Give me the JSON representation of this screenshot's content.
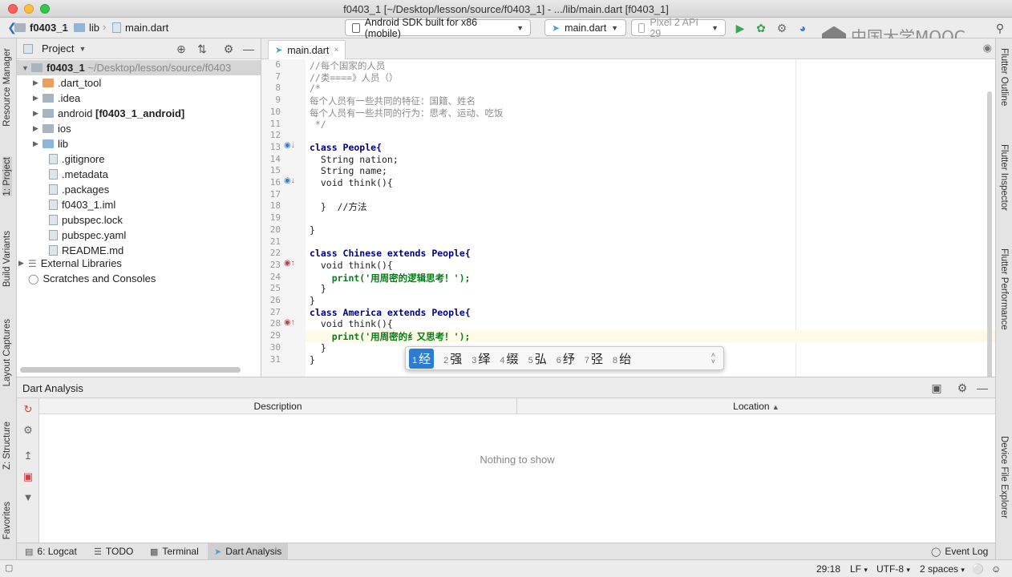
{
  "window": {
    "title": "f0403_1 [~/Desktop/lesson/source/f0403_1] - .../lib/main.dart [f0403_1]"
  },
  "navbar": {
    "crumbs": [
      "f0403_1",
      "lib",
      "main.dart"
    ],
    "device_combo": "Android SDK built for x86 (mobile)",
    "file_combo": "main.dart",
    "avd_combo": "Pixel 2 API 29"
  },
  "watermark": {
    "text": "中国大学MOOC"
  },
  "left_stripe": {
    "tabs": [
      "Resource Manager",
      "1: Project",
      "Build Variants",
      "Layout Captures",
      "Z: Structure",
      "Favorites"
    ]
  },
  "right_stripe": {
    "tabs": [
      "Flutter Outline",
      "Flutter Inspector",
      "Flutter Performance",
      "Device File Explorer"
    ]
  },
  "project": {
    "title": "Project",
    "root": {
      "name": "f0403_1",
      "path": "~/Desktop/lesson/source/f0403"
    },
    "items": [
      {
        "label": ".dart_tool",
        "suffix": ""
      },
      {
        "label": ".idea",
        "suffix": ""
      },
      {
        "label": "android",
        "suffix": "[f0403_1_android]"
      },
      {
        "label": "ios",
        "suffix": ""
      },
      {
        "label": "lib",
        "suffix": ""
      },
      {
        "label": ".gitignore",
        "suffix": ""
      },
      {
        "label": ".metadata",
        "suffix": ""
      },
      {
        "label": ".packages",
        "suffix": ""
      },
      {
        "label": "f0403_1.iml",
        "suffix": ""
      },
      {
        "label": "pubspec.lock",
        "suffix": ""
      },
      {
        "label": "pubspec.yaml",
        "suffix": ""
      },
      {
        "label": "README.md",
        "suffix": ""
      },
      {
        "label": "External Libraries",
        "suffix": ""
      },
      {
        "label": "Scratches and Consoles",
        "suffix": ""
      }
    ]
  },
  "editor": {
    "tab": "main.dart",
    "lines": [
      {
        "n": "6",
        "t": "//每个国家的人员"
      },
      {
        "n": "7",
        "t": "//类====》人员（）"
      },
      {
        "n": "8",
        "t": "/*"
      },
      {
        "n": "9",
        "t": "每个人员有一些共同的特征：国籍、姓名"
      },
      {
        "n": "10",
        "t": "每个人员有一些共同的行为：思考、运动、吃饭"
      },
      {
        "n": "11",
        "t": " */"
      },
      {
        "n": "12",
        "t": ""
      },
      {
        "n": "13",
        "t": "class People{"
      },
      {
        "n": "14",
        "t": "  String nation;"
      },
      {
        "n": "15",
        "t": "  String name;"
      },
      {
        "n": "16",
        "t": "  void think(){"
      },
      {
        "n": "17",
        "t": ""
      },
      {
        "n": "18",
        "t": "  }  //方法"
      },
      {
        "n": "19",
        "t": ""
      },
      {
        "n": "20",
        "t": "}"
      },
      {
        "n": "21",
        "t": ""
      },
      {
        "n": "22",
        "t": "class Chinese extends People{"
      },
      {
        "n": "23",
        "t": "  void think(){"
      },
      {
        "n": "24",
        "t": "    print('用周密的逻辑思考！');"
      },
      {
        "n": "25",
        "t": "  }"
      },
      {
        "n": "26",
        "t": "}"
      },
      {
        "n": "27",
        "t": "class America extends People{"
      },
      {
        "n": "28",
        "t": "  void think(){"
      },
      {
        "n": "29",
        "t": "    print('用周密的纟又思考！');"
      },
      {
        "n": "30",
        "t": "  }"
      },
      {
        "n": "31",
        "t": "}"
      }
    ]
  },
  "ime": {
    "candidates": [
      {
        "n": "1",
        "c": "经"
      },
      {
        "n": "2",
        "c": "强"
      },
      {
        "n": "3",
        "c": "绎"
      },
      {
        "n": "4",
        "c": "缀"
      },
      {
        "n": "5",
        "c": "弘"
      },
      {
        "n": "6",
        "c": "纾"
      },
      {
        "n": "7",
        "c": "弪"
      },
      {
        "n": "8",
        "c": "绐"
      }
    ]
  },
  "analysis": {
    "title": "Dart Analysis",
    "col_description": "Description",
    "col_location": "Location",
    "empty": "Nothing to show"
  },
  "bottom_tabs": [
    "6: Logcat",
    "TODO",
    "Terminal",
    "Dart Analysis"
  ],
  "event_log": "Event Log",
  "status": {
    "position": "29:18",
    "line_sep": "LF",
    "encoding": "UTF-8",
    "indent": "2 spaces"
  }
}
